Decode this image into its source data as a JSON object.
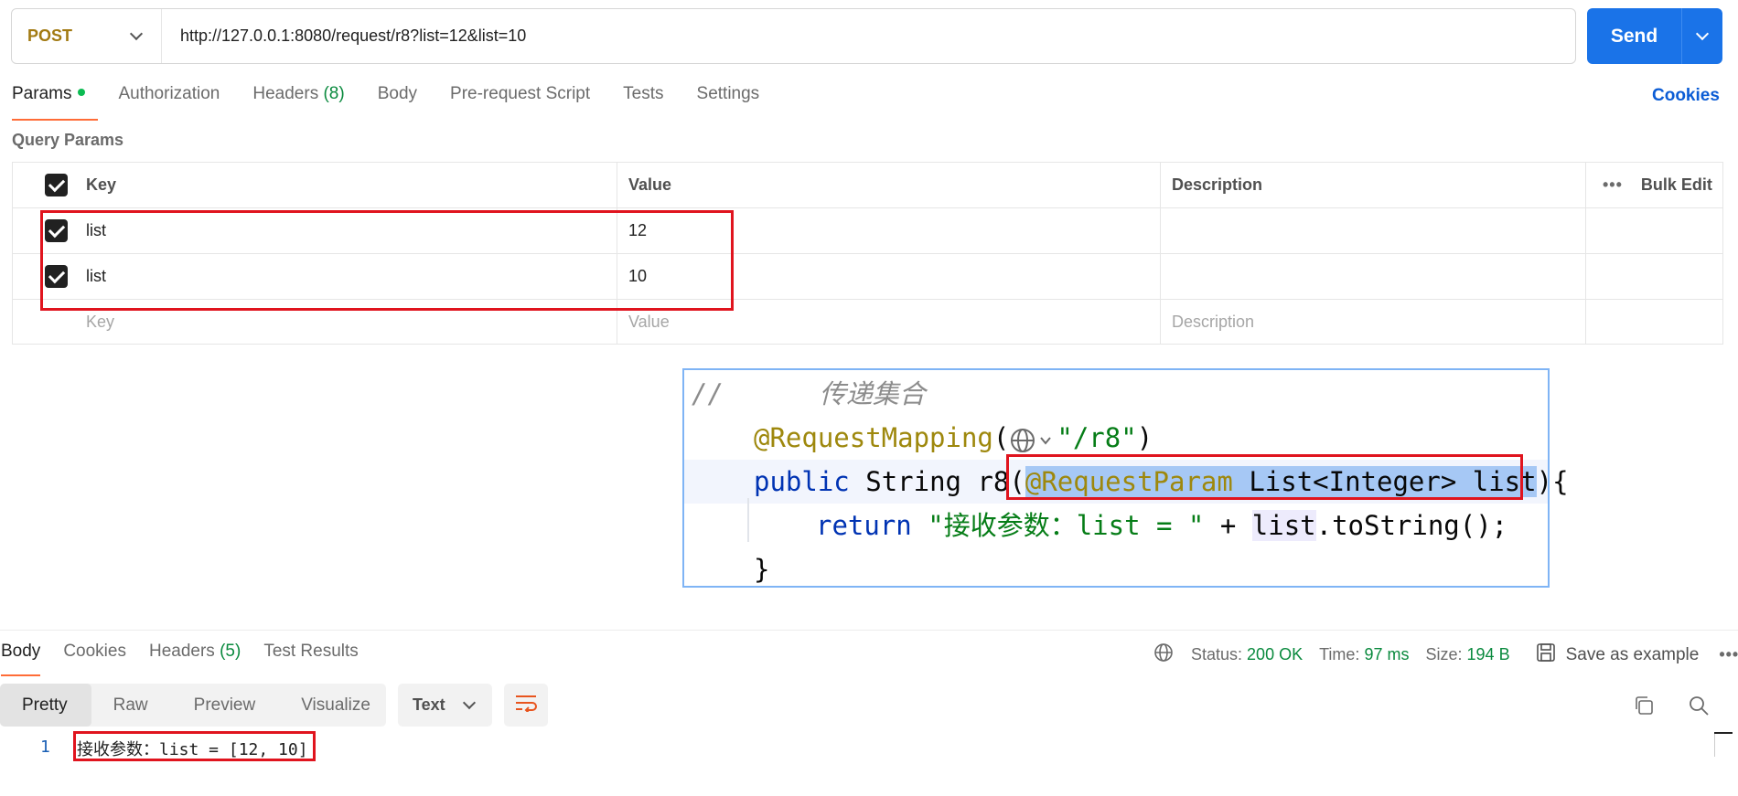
{
  "request": {
    "method": "POST",
    "url": "http://127.0.0.1:8080/request/r8?list=12&list=10",
    "send_label": "Send"
  },
  "tabs": [
    {
      "label": "Params",
      "active": true
    },
    {
      "label": "Authorization"
    },
    {
      "label": "Headers",
      "count": "(8)"
    },
    {
      "label": "Body"
    },
    {
      "label": "Pre-request Script"
    },
    {
      "label": "Tests"
    },
    {
      "label": "Settings"
    }
  ],
  "cookies_label": "Cookies",
  "query_params": {
    "title": "Query Params",
    "headers": {
      "key": "Key",
      "value": "Value",
      "description": "Description",
      "bulk_edit": "Bulk Edit"
    },
    "rows": [
      {
        "checked": true,
        "key": "list",
        "value": "12",
        "description": ""
      },
      {
        "checked": true,
        "key": "list",
        "value": "10",
        "description": ""
      }
    ],
    "placeholders": {
      "key": "Key",
      "value": "Value",
      "description": "Description"
    }
  },
  "code_snippet": {
    "comment_slashes": "//",
    "comment_text": "传递集合",
    "annotation": "@RequestMapping",
    "mapping_path": "\"/r8\"",
    "kw_public": "public",
    "return_type": "String",
    "method_name": "r8",
    "param_annotation": "@RequestParam",
    "param_type": "List<Integer>",
    "param_name": "list",
    "kw_return": "return",
    "return_string": "\"接收参数：list = \"",
    "return_plus": "+",
    "return_var": "list",
    "return_call": ".toString();",
    "close_brace": "}"
  },
  "response": {
    "tabs": [
      {
        "label": "Body",
        "active": true
      },
      {
        "label": "Cookies"
      },
      {
        "label": "Headers",
        "count": "(5)"
      },
      {
        "label": "Test Results"
      }
    ],
    "status_label": "Status:",
    "status_value": "200 OK",
    "time_label": "Time:",
    "time_value": "97 ms",
    "size_label": "Size:",
    "size_value": "194 B",
    "save_example": "Save as example",
    "views": [
      "Pretty",
      "Raw",
      "Preview",
      "Visualize"
    ],
    "active_view": "Pretty",
    "format": "Text",
    "line_number": "1",
    "body_text": "接收参数：list = [12, 10]"
  },
  "colors": {
    "method": "#a27a12",
    "send": "#1a73e8",
    "accent": "#ff6c37",
    "success": "#0a8a3e",
    "highlight_box": "#e0141e"
  },
  "icons": [
    "chevron-down-icon",
    "checkbox-checked-icon",
    "more-horizontal-icon",
    "globe-icon",
    "save-icon",
    "wrap-lines-icon",
    "copy-icon",
    "search-icon"
  ]
}
